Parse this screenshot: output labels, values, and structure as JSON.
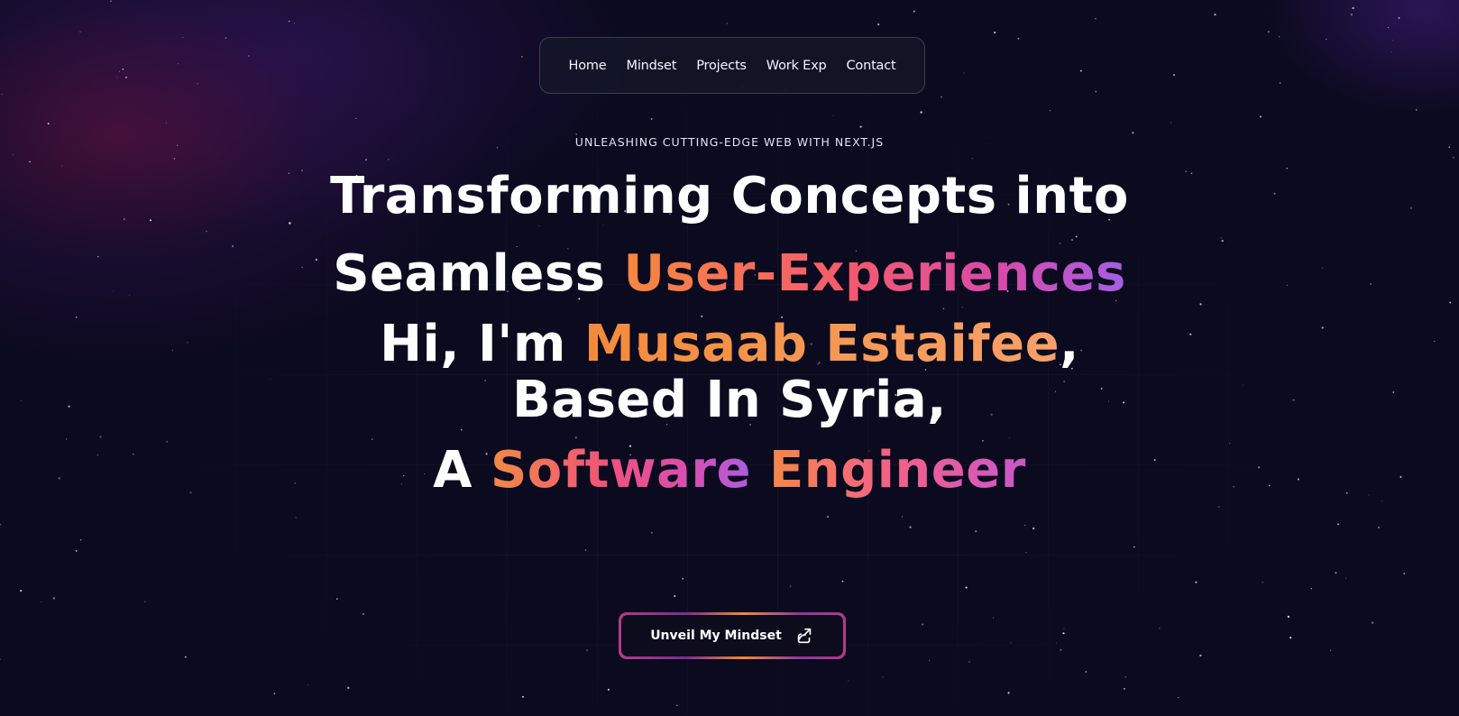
{
  "nav": {
    "items": [
      {
        "label": "Home"
      },
      {
        "label": "Mindset"
      },
      {
        "label": "Projects"
      },
      {
        "label": "Work Exp"
      },
      {
        "label": "Contact"
      }
    ]
  },
  "hero": {
    "tagline": "UNLEASHING CUTTING-EDGE WEB WITH NEXT.JS",
    "line1": "Transforming Concepts into",
    "line2_plain": "Seamless ",
    "line2_highlight": "User-Experiences",
    "line3_plain": "Hi, I'm ",
    "line3_highlight": "Musaab Estaifee",
    "line3_suffix": ",",
    "line4": "Based In Syria,",
    "line5_plain": "A ",
    "line5_highlight1": "Software",
    "line5_space": " ",
    "line5_highlight2": "Engineer"
  },
  "cta": {
    "label": "Unveil My Mindset",
    "icon": "share-arrow-icon"
  },
  "colors": {
    "background": "#0b0a1f",
    "accent_orange": "#f6873f",
    "accent_pink": "#f0527a",
    "accent_purple": "#a55ee6"
  }
}
